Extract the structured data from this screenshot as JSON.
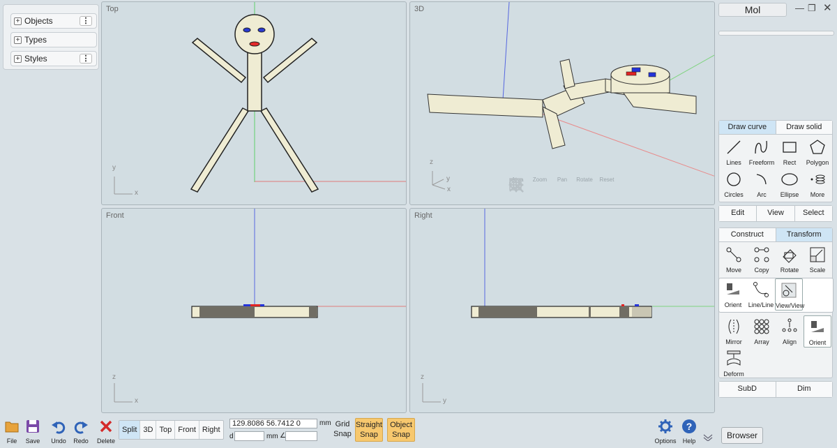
{
  "left_panel": {
    "items": [
      {
        "label": "Objects",
        "has_menu": true
      },
      {
        "label": "Types",
        "has_menu": false
      },
      {
        "label": "Styles",
        "has_menu": true
      }
    ]
  },
  "viewports": {
    "top": {
      "title": "Top",
      "axis_y": "y",
      "axis_x": "x"
    },
    "3d": {
      "title": "3D",
      "axis_z": "z",
      "axis_y": "y",
      "axis_x": "x"
    },
    "front": {
      "title": "Front",
      "axis_y": "z",
      "axis_x": "x"
    },
    "right": {
      "title": "Right",
      "axis_y": "z",
      "axis_x": "y"
    }
  },
  "view_toolbar": [
    "Area",
    "Zoom",
    "Pan",
    "Rotate",
    "Reset"
  ],
  "right_panel": {
    "title": "Mol",
    "draw_tabs": [
      "Draw curve",
      "Draw solid"
    ],
    "draw_tools": [
      "Lines",
      "Freeform",
      "Rect",
      "Polygon",
      "Circles",
      "Arc",
      "Ellipse",
      "More"
    ],
    "mode_buttons": [
      "Edit",
      "View",
      "Select"
    ],
    "transform_tabs": [
      "Construct",
      "Transform"
    ],
    "transform_tools": [
      "Move",
      "Copy",
      "Rotate",
      "Scale"
    ],
    "orient_tools": [
      "Orient",
      "Line/Line",
      "View/View"
    ],
    "transform_tools2": [
      "Mirror",
      "Array",
      "Align",
      "Orient"
    ],
    "deform_label": "Deform",
    "bottom_buttons": [
      "SubD",
      "Dim"
    ]
  },
  "bottom_bar": {
    "file": "File",
    "save": "Save",
    "undo": "Undo",
    "redo": "Redo",
    "delete": "Delete",
    "views": [
      "Split",
      "3D",
      "Top",
      "Front",
      "Right"
    ],
    "coords": "129.8086   56.7412   0",
    "unit": "mm",
    "d_label": "d",
    "unit2": "mm",
    "grid_snap": "Grid\nSnap",
    "straight_snap": "Straight\nSnap",
    "object_snap": "Object\nSnap",
    "options": "Options",
    "help": "Help",
    "browser": "Browser"
  },
  "colors": {
    "accent": "#cfe5f5",
    "snap": "#f7c86e",
    "figure_fill": "#efecd3",
    "shadow": "#706d64"
  }
}
